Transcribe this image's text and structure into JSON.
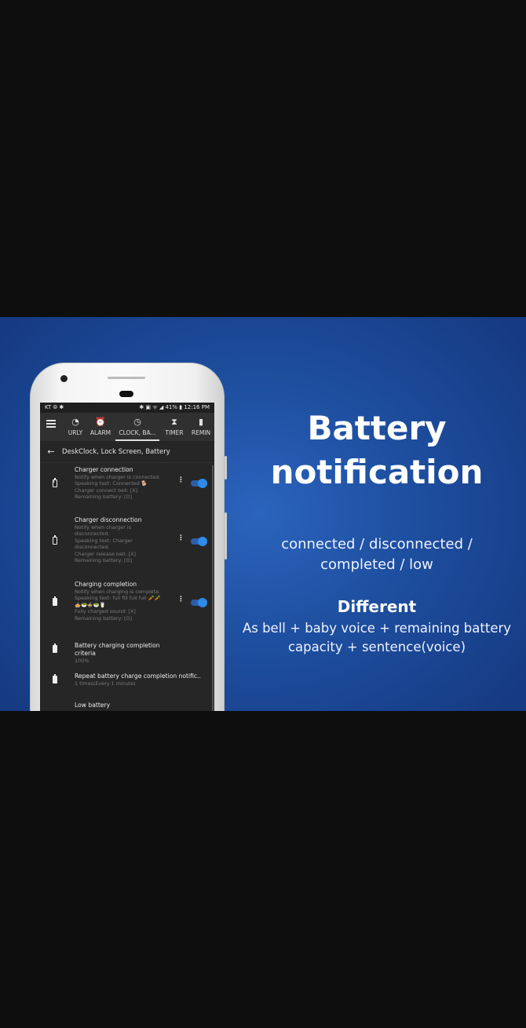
{
  "status_bar": {
    "left": "KT ⦾ ✱",
    "right": "✱ ▣ ᯤ ◢ 41% ▮ 12:16 PM"
  },
  "tabs": [
    {
      "label": "URLY",
      "icon": "hourly-icon",
      "glyph": "◔"
    },
    {
      "label": "ALARM",
      "icon": "alarm-clock-icon",
      "glyph": "⏰"
    },
    {
      "label": "CLOCK, BA...",
      "icon": "clock-icon",
      "glyph": "◷"
    },
    {
      "label": "TIMER",
      "icon": "hourglass-icon",
      "glyph": "⧗"
    },
    {
      "label": "REMIN",
      "icon": "reminder-icon",
      "glyph": "▮"
    }
  ],
  "subheader": {
    "back_glyph": "←",
    "title": "DeskClock, Lock Screen, Battery"
  },
  "settings": [
    {
      "title": "Charger connection",
      "lines": [
        "Notify when charger is connected.",
        "Speaking text: Connected 🐕",
        "Charger connect bell: [X]",
        "Remaining battery: [O]"
      ],
      "icon": "battery-charging-icon",
      "has_toggle": true,
      "toggle_on": true
    },
    {
      "title": "Charger disconnection",
      "lines": [
        "Notify when charger is",
        "disconnected.",
        "Speaking text: Charger",
        "disconnected.",
        "Charger release bell: [X]",
        "Remaining battery: [O]"
      ],
      "icon": "battery-unknown-icon",
      "has_toggle": true,
      "toggle_on": true
    },
    {
      "title": "Charging completion",
      "lines": [
        "Notify when charging is complete.",
        "Speaking text: full fill full full 🥕🥕",
        "🥧🥗🍲🥗🥛",
        "Fully charged sound: [X]",
        "Remaining battery: [O]"
      ],
      "icon": "battery-full-icon",
      "has_toggle": true,
      "toggle_on": true
    },
    {
      "title": "Battery charging completion criteria",
      "lines": [
        "100%"
      ],
      "icon": "battery-full-icon",
      "has_toggle": false
    },
    {
      "title": "Repeat battery charge completion notific..",
      "lines": [
        "1 times(Every 1 minute)"
      ],
      "icon": "battery-full-icon",
      "has_toggle": false
    },
    {
      "title": "Low battery",
      "lines": [],
      "icon": "battery-low-icon",
      "has_toggle": false
    }
  ],
  "promo": {
    "headline_line1": "Battery",
    "headline_line2": "notification",
    "events_line1": "connected / disconnected /",
    "events_line2": "completed / low",
    "different_title": "Different",
    "different_line1": "As bell + baby voice + remaining battery",
    "different_line2": "capacity + sentence(voice)"
  },
  "colors": {
    "banner_bg": "#1e4fa0",
    "toggle_accent": "#2e8bea",
    "screen_bg": "#262626"
  }
}
